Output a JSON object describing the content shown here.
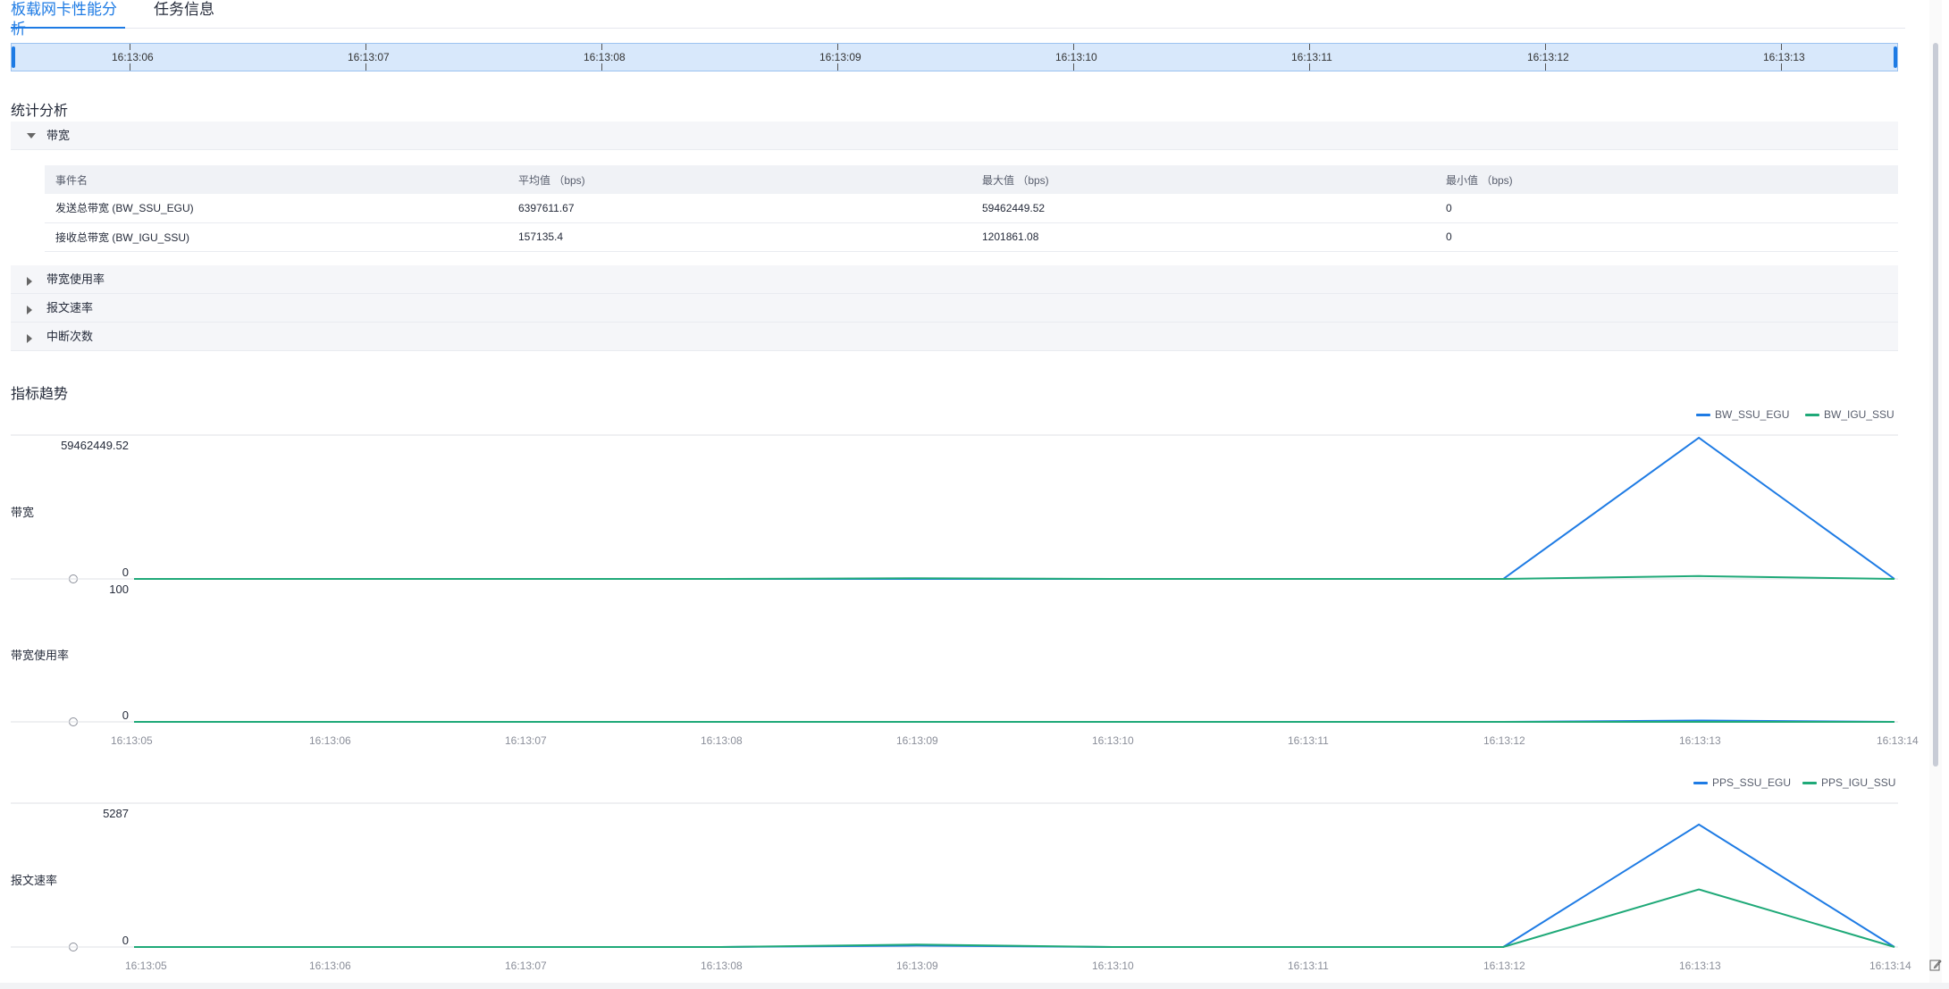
{
  "tabs": [
    {
      "label": "板载网卡性能分析"
    },
    {
      "label": "任务信息"
    }
  ],
  "timeline": {
    "ticks": [
      "16:13:06",
      "16:13:07",
      "16:13:08",
      "16:13:09",
      "16:13:10",
      "16:13:11",
      "16:13:12",
      "16:13:13"
    ]
  },
  "stats": {
    "title": "统计分析",
    "bandwidth_section": "带宽",
    "columns": [
      "事件名",
      "平均值 （bps)",
      "最大值 （bps)",
      "最小值 （bps)"
    ],
    "rows": [
      [
        "发送总带宽 (BW_SSU_EGU)",
        "6397611.67",
        "59462449.52",
        "0"
      ],
      [
        "接收总带宽 (BW_IGU_SSU)",
        "157135.4",
        "1201861.08",
        "0"
      ]
    ],
    "collapsed_sections": [
      "带宽使用率",
      "报文速率",
      "中断次数"
    ]
  },
  "trend": {
    "title": "指标趋势",
    "colors": {
      "egu": "#1e7be4",
      "igu": "#1fa978"
    },
    "chart1": {
      "legend": [
        "BW_SSU_EGU",
        "BW_IGU_SSU"
      ],
      "panel1_label": "带宽",
      "panel1_max": "59462449.52",
      "panel1_min": "0",
      "panel2_max": "100",
      "panel2_label": "带宽使用率",
      "panel2_min": "0",
      "x_ticks": [
        "16:13:05",
        "16:13:06",
        "16:13:07",
        "16:13:08",
        "16:13:09",
        "16:13:10",
        "16:13:11",
        "16:13:12",
        "16:13:13",
        "16:13:14"
      ]
    },
    "chart2": {
      "legend": [
        "PPS_SSU_EGU",
        "PPS_IGU_SSU"
      ],
      "panel_label": "报文速率",
      "max": "5287",
      "min": "0",
      "x_ticks": [
        "16:13:05",
        "16:13:06",
        "16:13:07",
        "16:13:08",
        "16:13:09",
        "16:13:10",
        "16:13:11",
        "16:13:12",
        "16:13:13",
        "16:13:14"
      ]
    }
  },
  "chart_data": [
    {
      "type": "line",
      "ylabel": "带宽",
      "x": [
        "16:13:05",
        "16:13:06",
        "16:13:07",
        "16:13:08",
        "16:13:09",
        "16:13:10",
        "16:13:11",
        "16:13:12",
        "16:13:13",
        "16:13:14"
      ],
      "ylim": [
        0,
        59462449.52
      ],
      "series": [
        {
          "name": "BW_SSU_EGU",
          "values": [
            0,
            0,
            0,
            0,
            0,
            0,
            0,
            0,
            59462449.52,
            0
          ]
        },
        {
          "name": "BW_IGU_SSU",
          "values": [
            0,
            0,
            0,
            0,
            300000,
            0,
            0,
            0,
            1201861.08,
            0
          ]
        }
      ]
    },
    {
      "type": "line",
      "ylabel": "带宽使用率",
      "x": [
        "16:13:05",
        "16:13:06",
        "16:13:07",
        "16:13:08",
        "16:13:09",
        "16:13:10",
        "16:13:11",
        "16:13:12",
        "16:13:13",
        "16:13:14"
      ],
      "ylim": [
        0,
        100
      ],
      "series": [
        {
          "name": "BW_SSU_EGU",
          "values": [
            0,
            0,
            0,
            0,
            0,
            0,
            0,
            0,
            1,
            0
          ]
        },
        {
          "name": "BW_IGU_SSU",
          "values": [
            0,
            0,
            0,
            0,
            0,
            0,
            0,
            0,
            0,
            0
          ]
        }
      ]
    },
    {
      "type": "line",
      "ylabel": "报文速率",
      "x": [
        "16:13:05",
        "16:13:06",
        "16:13:07",
        "16:13:08",
        "16:13:09",
        "16:13:10",
        "16:13:11",
        "16:13:12",
        "16:13:13",
        "16:13:14"
      ],
      "ylim": [
        0,
        5287
      ],
      "series": [
        {
          "name": "PPS_SSU_EGU",
          "values": [
            0,
            0,
            0,
            0,
            60,
            0,
            0,
            0,
            5000,
            0
          ]
        },
        {
          "name": "PPS_IGU_SSU",
          "values": [
            0,
            0,
            0,
            0,
            100,
            0,
            0,
            0,
            2350,
            0
          ]
        }
      ]
    }
  ]
}
